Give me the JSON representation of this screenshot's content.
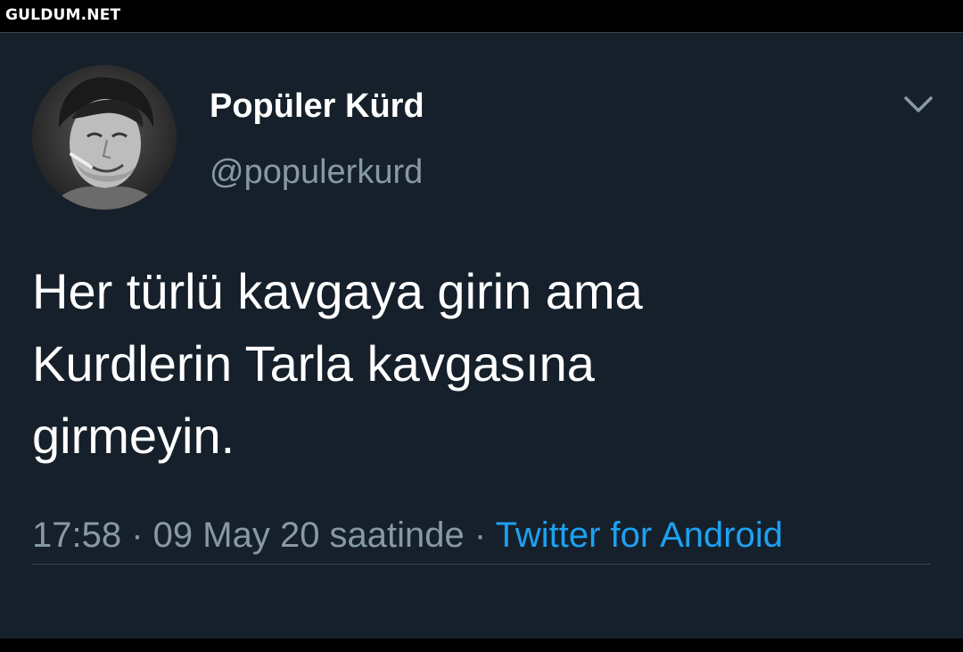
{
  "watermark": "GULDUM.NET",
  "tweet": {
    "display_name": "Popüler Kürd",
    "handle": "@populerkurd",
    "text_lines": [
      "Her türlü kavgaya girin ama",
      "Kurdlerin Tarla kavgasına",
      "girmeyin."
    ],
    "time": "17:58",
    "separator": " · ",
    "date": "09 May 20 saatinde",
    "source": "Twitter for Android",
    "menu_icon": "chevron-down-icon"
  },
  "colors": {
    "background": "#15202b",
    "text_primary": "#ffffff",
    "text_secondary": "#8899a6",
    "accent": "#1da1f2",
    "divider": "#38444d"
  }
}
